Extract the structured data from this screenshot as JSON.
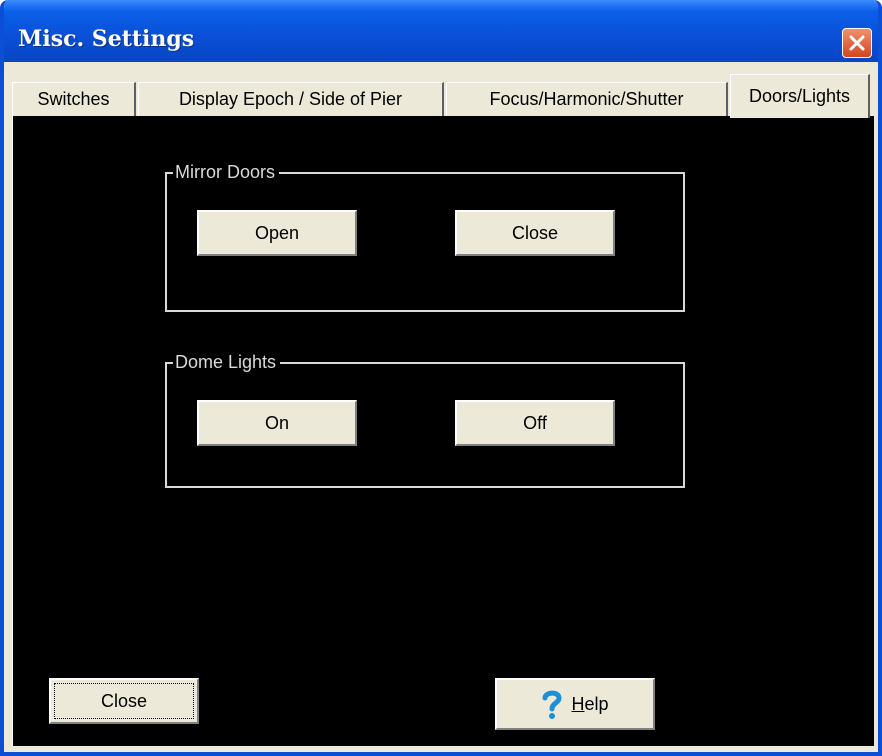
{
  "window": {
    "title": "Misc. Settings",
    "close_icon": "close-x-icon"
  },
  "tabs": [
    {
      "label": "Switches",
      "active": false
    },
    {
      "label": "Display Epoch / Side of Pier",
      "active": false
    },
    {
      "label": "Focus/Harmonic/Shutter",
      "active": false
    },
    {
      "label": "Doors/Lights",
      "active": true
    }
  ],
  "mirror_doors": {
    "label": "Mirror Doors",
    "open_label": "Open",
    "close_label": "Close"
  },
  "dome_lights": {
    "label": "Dome Lights",
    "on_label": "On",
    "off_label": "Off"
  },
  "footer": {
    "close_label": "Close",
    "help_first": "H",
    "help_rest": "elp",
    "help_icon": "question-mark-icon"
  },
  "colors": {
    "titlebar": "#0a4fd6",
    "panel_bg": "#000000",
    "button_face": "#ece9d8",
    "close_button": "#d3451f",
    "help_icon": "#1c8fd8"
  }
}
